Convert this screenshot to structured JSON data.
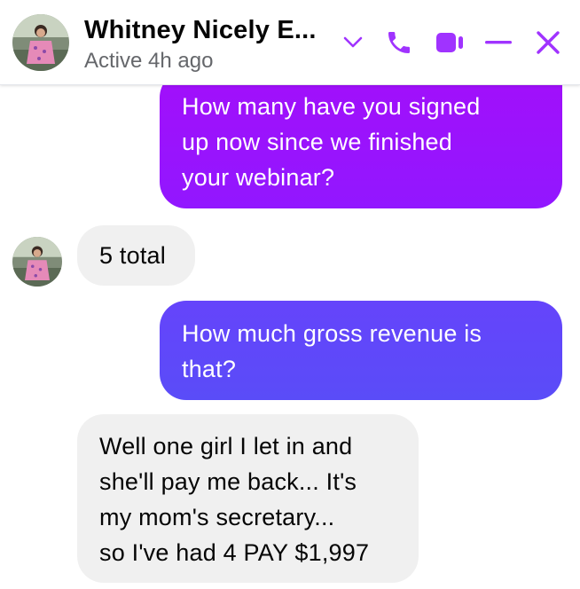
{
  "header": {
    "contact_name": "Whitney Nicely E...",
    "status": "Active 4h ago",
    "icons": [
      "chevron-down-icon",
      "phone-icon",
      "video-icon",
      "minimize-icon",
      "close-icon"
    ]
  },
  "messages": [
    {
      "direction": "outgoing",
      "lines": [
        "How many have you signed",
        "up now since we finished",
        "your webinar?"
      ]
    },
    {
      "direction": "incoming",
      "lines": [
        "5 total"
      ]
    },
    {
      "direction": "outgoing",
      "lines": [
        "How much gross revenue is",
        "that?"
      ]
    },
    {
      "direction": "incoming",
      "lines": [
        "Well one girl I let in and",
        "she'll pay me back... It's",
        "my mom's secretary...",
        "so I've had 4 PAY $1,997"
      ]
    }
  ],
  "colors": {
    "accent": "#a033ff",
    "outgoing_top": "#a20ffa",
    "outgoing_bottom": "#5a4cf8",
    "incoming_bg": "#f0f0f0",
    "status_gray": "#65676b"
  }
}
